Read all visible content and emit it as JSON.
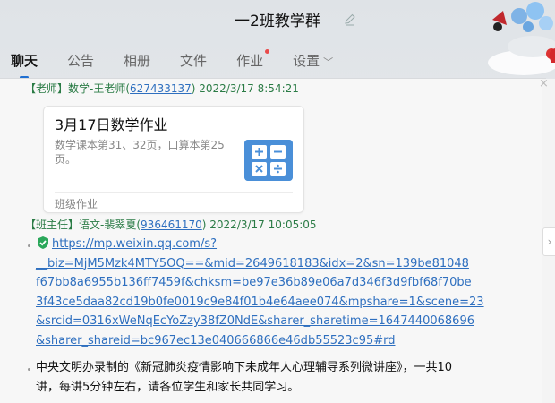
{
  "window": {
    "title": "一2班教学群"
  },
  "tabs": [
    {
      "label": "聊天",
      "active": true
    },
    {
      "label": "公告"
    },
    {
      "label": "相册"
    },
    {
      "label": "文件"
    },
    {
      "label": "作业",
      "badge": true
    },
    {
      "label": "设置",
      "chevron": "﹀"
    }
  ],
  "messages": {
    "teacher": {
      "role": "【老师】",
      "name": "数学-王老师",
      "qq_open": "(",
      "qq": "627433137",
      "qq_close": ")",
      "time": "2022/3/17 8:54:21",
      "card": {
        "title": "3月17日数学作业",
        "desc": "数学课本第31、32页，口算本第25页。",
        "footer": "班级作业",
        "icon": "calculator-icon"
      }
    },
    "head_teacher": {
      "role": "【班主任】",
      "name": "语文-裴翠夏",
      "qq_open": "(",
      "qq": "936461170",
      "qq_close": ")",
      "time": "2022/3/17 10:05:05",
      "link_lines": [
        "https://mp.weixin.qq.com/s?",
        "__biz=MjM5Mzk4MTY5OQ==&mid=2649618183&idx=2&sn=139be81048",
        "f67bb8a6955b136ff7459f&chksm=be97e36b89e06a7d346f3d9fbf68f70be",
        "3f43ce5daa82cd19b0fe0019c9e84f01b4e64aee074&mpshare=1&scene=23",
        "&srcid=0316xWeNqEcYoZzy38fZ0NdE&sharer_sharetime=1647440068696",
        "&sharer_shareid=bc967ec13e040666866e46db55523c95#rd"
      ],
      "text_lines": [
        "中央文明办录制的《新冠肺炎疫情影响下未成年人心理辅导系列微讲座》，一共10",
        "讲，每讲5分钟左右，请各位学生和家长共同学习。"
      ]
    }
  },
  "colors": {
    "accent": "#1f6fd1",
    "link": "#2e6fbf",
    "sender": "#2a7b45",
    "badge": "#e94a4a"
  }
}
